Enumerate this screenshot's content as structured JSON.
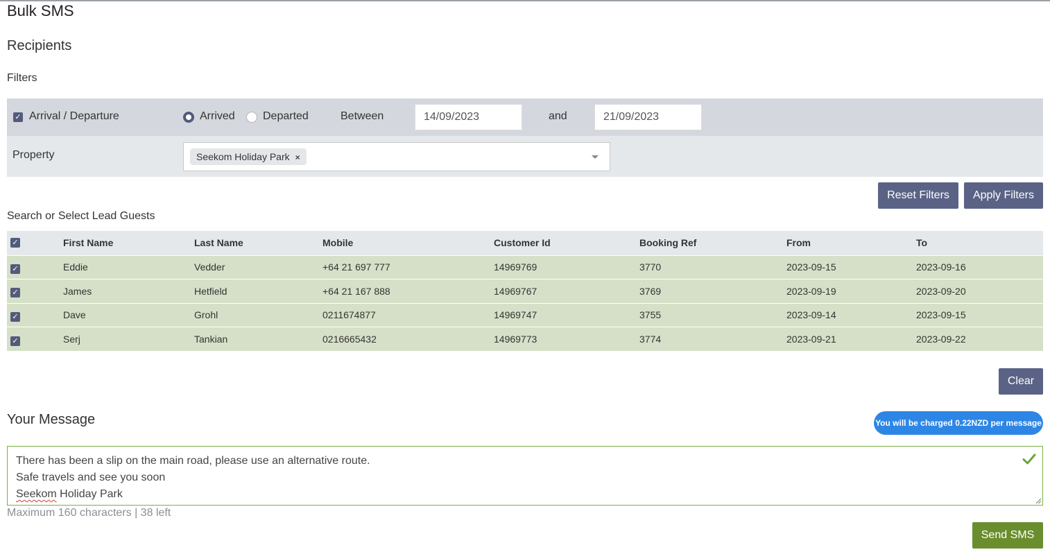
{
  "page": {
    "title": "Bulk SMS"
  },
  "recipients": {
    "title": "Recipients",
    "filters_label": "Filters",
    "arrival_departure": {
      "label": "Arrival / Departure",
      "checked": true
    },
    "status_options": [
      {
        "label": "Arrived",
        "selected": true
      },
      {
        "label": "Departed",
        "selected": false
      }
    ],
    "between_label": "Between",
    "date_from": "14/09/2023",
    "and_label": "and",
    "date_to": "21/09/2023",
    "property": {
      "label": "Property",
      "selected_tags": [
        "Seekom Holiday Park"
      ],
      "tag_remove_icon": "×"
    },
    "buttons": {
      "reset": "Reset Filters",
      "apply": "Apply Filters"
    }
  },
  "guests": {
    "search_label": "Search or Select Lead Guests",
    "columns": [
      "First Name",
      "Last Name",
      "Mobile",
      "Customer Id",
      "Booking Ref",
      "From",
      "To"
    ],
    "rows": [
      {
        "first": "Eddie",
        "last": "Vedder",
        "mobile": "+64 21 697 777",
        "customer_id": "14969769",
        "booking_ref": "3770",
        "from": "2023-09-15",
        "to": "2023-09-16",
        "selected": true
      },
      {
        "first": "James",
        "last": "Hetfield",
        "mobile": "+64 21 167 888",
        "customer_id": "14969767",
        "booking_ref": "3769",
        "from": "2023-09-19",
        "to": "2023-09-20",
        "selected": true
      },
      {
        "first": "Dave",
        "last": "Grohl",
        "mobile": "0211674877",
        "customer_id": "14969747",
        "booking_ref": "3755",
        "from": "2023-09-14",
        "to": "2023-09-15",
        "selected": true
      },
      {
        "first": "Serj",
        "last": "Tankian",
        "mobile": "0216665432",
        "customer_id": "14969773",
        "booking_ref": "3774",
        "from": "2023-09-21",
        "to": "2023-09-22",
        "selected": true
      }
    ],
    "clear_button": "Clear"
  },
  "message": {
    "title": "Your Message",
    "charge_notice": "You will be charged 0.22NZD per message",
    "lines": [
      "There has been a slip on the main road, please use an alternative route.",
      "Safe travels and see you soon"
    ],
    "signature_misspelled": "Seekom",
    "signature_rest": " Holiday Park",
    "counter": "Maximum 160 characters | 38 left",
    "send_button": "Send SMS"
  },
  "colors": {
    "accent": "#5a6385",
    "checkbox": "#535b7c",
    "row_selected": "#d6e0c8",
    "send": "#6a8e2e",
    "pill": "#2d86e6",
    "valid_border": "#7ab13f"
  },
  "icons": {
    "checkbox": "check-icon",
    "dropdown": "chevron-down-icon",
    "valid": "checkmark-icon",
    "resize": "resize-handle-icon"
  }
}
